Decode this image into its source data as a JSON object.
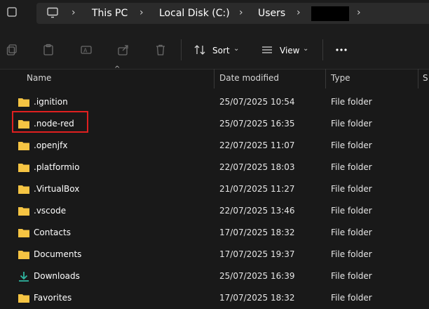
{
  "address_bar": {
    "breadcrumbs": [
      "This PC",
      "Local Disk (C:)",
      "Users"
    ],
    "icons": [
      "folder-window-icon",
      "monitor-icon",
      "chevron-right-icon"
    ]
  },
  "toolbar": {
    "sort_label": "Sort",
    "view_label": "View",
    "icons": [
      "copy-icon",
      "paste-icon",
      "rename-icon",
      "share-icon",
      "delete-icon",
      "sort-icon",
      "view-icon",
      "more-icon"
    ]
  },
  "columns": {
    "name": "Name",
    "date": "Date modified",
    "type": "Type",
    "size_partial": "S"
  },
  "files": [
    {
      "name": ".ignition",
      "date": "25/07/2025 10:54",
      "type": "File folder",
      "icon": "folder-icon"
    },
    {
      "name": ".node-red",
      "date": "25/07/2025 16:35",
      "type": "File folder",
      "icon": "folder-icon"
    },
    {
      "name": ".openjfx",
      "date": "22/07/2025 11:07",
      "type": "File folder",
      "icon": "folder-icon"
    },
    {
      "name": ".platformio",
      "date": "22/07/2025 18:03",
      "type": "File folder",
      "icon": "folder-icon"
    },
    {
      "name": ".VirtualBox",
      "date": "21/07/2025 11:27",
      "type": "File folder",
      "icon": "folder-icon"
    },
    {
      "name": ".vscode",
      "date": "22/07/2025 13:46",
      "type": "File folder",
      "icon": "folder-icon"
    },
    {
      "name": "Contacts",
      "date": "17/07/2025 18:32",
      "type": "File folder",
      "icon": "folder-icon"
    },
    {
      "name": "Documents",
      "date": "17/07/2025 19:37",
      "type": "File folder",
      "icon": "folder-icon"
    },
    {
      "name": "Downloads",
      "date": "25/07/2025 16:39",
      "type": "File folder",
      "icon": "download-icon"
    },
    {
      "name": "Favorites",
      "date": "17/07/2025 18:32",
      "type": "File folder",
      "icon": "folder-icon"
    }
  ],
  "colors": {
    "background": "#191919",
    "folder": "#f5c443",
    "download": "#2fb5a0",
    "highlight": "#e02020"
  }
}
